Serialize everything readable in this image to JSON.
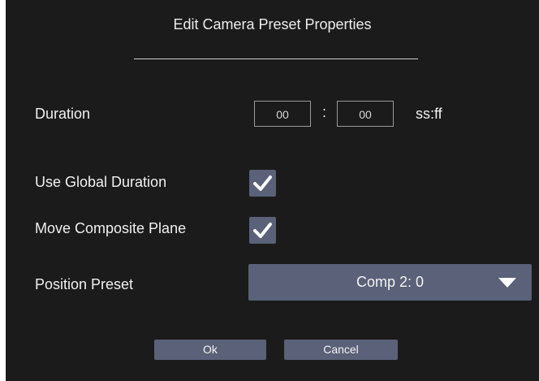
{
  "dialog": {
    "title": "Edit Camera Preset Properties"
  },
  "duration": {
    "label": "Duration",
    "seconds": "00",
    "frames": "00",
    "separator": ":",
    "unit": "ss:ff"
  },
  "use_global_duration": {
    "label": "Use Global Duration",
    "checked": true,
    "icon": "checkmark-icon"
  },
  "move_composite_plane": {
    "label": "Move Composite Plane",
    "checked": true,
    "icon": "checkmark-icon"
  },
  "position_preset": {
    "label": "Position Preset",
    "selected": "Comp 2: 0",
    "icon": "dropdown-arrow-icon"
  },
  "buttons": {
    "ok": "Ok",
    "cancel": "Cancel"
  },
  "colors": {
    "background": "#1b1b1b",
    "control": "#5a6178",
    "text": "#f0f0f0"
  }
}
